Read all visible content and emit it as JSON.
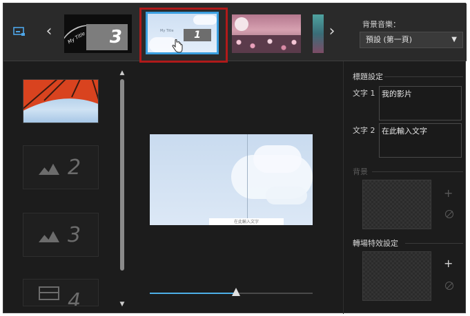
{
  "filmstrip": {
    "thumb1_title": "My Title",
    "thumb1_number": "3",
    "thumb2_small_text": "My Title",
    "thumb2_number": "1"
  },
  "music": {
    "label": "背景音樂：",
    "selected": "預設 (第一頁)"
  },
  "slots": [
    {
      "number": "2"
    },
    {
      "number": "3"
    },
    {
      "number": "4"
    }
  ],
  "preview": {
    "caption": "在此輸入文字"
  },
  "slider": {
    "position_fraction": 0.53
  },
  "panel": {
    "title_settings": "標題設定",
    "text1_label": "文字 1",
    "text1_value": "我的影片",
    "text2_label": "文字 2",
    "text2_value": "在此輸入文字",
    "background_title": "背景",
    "transition_title": "轉場特效設定"
  },
  "colors": {
    "selection_border": "#b01a1a",
    "active_thumb_border": "#3a9fe0",
    "slider_fill": "#4eb0e8"
  }
}
